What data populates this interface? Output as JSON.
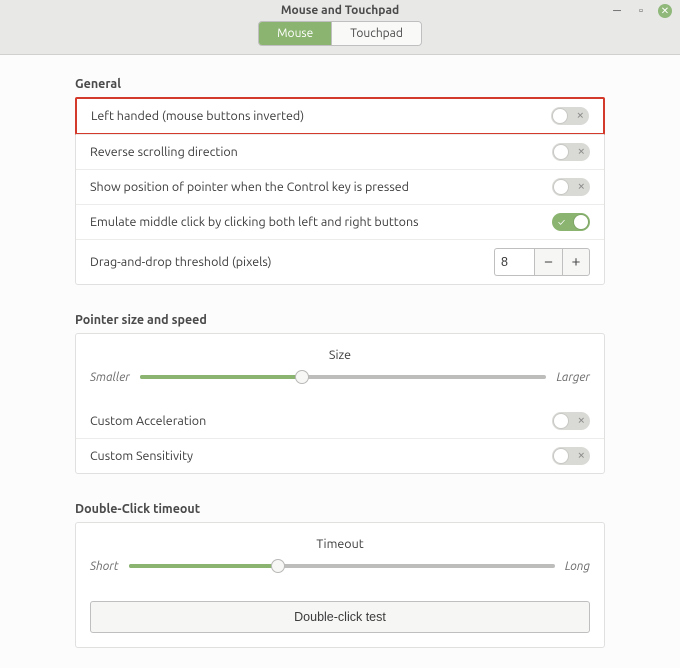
{
  "window": {
    "title": "Mouse and Touchpad"
  },
  "tabs": [
    {
      "label": "Mouse",
      "active": true
    },
    {
      "label": "Touchpad",
      "active": false
    }
  ],
  "sections": {
    "general": {
      "title": "General",
      "left_handed": {
        "label": "Left handed (mouse buttons inverted)",
        "on": false
      },
      "reverse_scrolling": {
        "label": "Reverse scrolling direction",
        "on": false
      },
      "locate_pointer": {
        "label": "Show position of pointer when the Control key is pressed",
        "on": false
      },
      "middle_click_emulation": {
        "label": "Emulate middle click by clicking both left and right buttons",
        "on": true
      },
      "dnd_threshold": {
        "label": "Drag-and-drop threshold (pixels)",
        "value": "8"
      }
    },
    "pointer": {
      "title": "Pointer size and speed",
      "size": {
        "label": "Size",
        "min_label": "Smaller",
        "max_label": "Larger",
        "value_pct": 40
      },
      "custom_acceleration": {
        "label": "Custom Acceleration",
        "on": false
      },
      "custom_sensitivity": {
        "label": "Custom Sensitivity",
        "on": false
      }
    },
    "double_click": {
      "title": "Double-Click timeout",
      "timeout": {
        "label": "Timeout",
        "min_label": "Short",
        "max_label": "Long",
        "value_pct": 35
      },
      "test_button": "Double-click test"
    }
  }
}
